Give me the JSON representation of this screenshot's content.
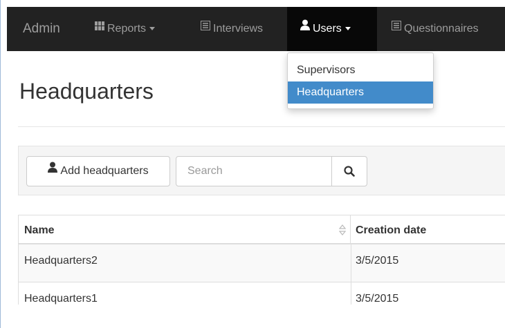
{
  "navbar": {
    "brand": "Admin",
    "items": [
      {
        "label": "Reports",
        "icon": "bar-chart-icon",
        "has_caret": true
      },
      {
        "label": "Interviews",
        "icon": "list-icon"
      },
      {
        "label": "Users",
        "icon": "user-icon",
        "has_caret": true,
        "active": true
      },
      {
        "label": "Questionnaires",
        "icon": "list-icon"
      }
    ]
  },
  "users_dropdown": {
    "items": [
      {
        "label": "Supervisors"
      },
      {
        "label": "Headquarters",
        "active": true
      }
    ]
  },
  "page": {
    "title": "Headquarters"
  },
  "toolbar": {
    "add_button_label": "Add headquarters",
    "add_button_icon": "user-icon",
    "search_placeholder": "Search",
    "search_value": "",
    "search_icon": "search-icon"
  },
  "table": {
    "columns": [
      "Name",
      "Creation date"
    ],
    "sort_icon": "sort-icon",
    "rows": [
      {
        "name": "Headquarters2",
        "creation_date": "3/5/2015"
      },
      {
        "name": "Headquarters1",
        "creation_date": "3/5/2015"
      }
    ]
  },
  "colors": {
    "navbar_bg": "#222222",
    "navbar_active_bg": "#080808",
    "nav_text": "#9d9d9d",
    "dropdown_active_bg": "#428bca",
    "toolbar_bg": "#f5f5f5",
    "row_stripe": "#f9f9f9"
  }
}
